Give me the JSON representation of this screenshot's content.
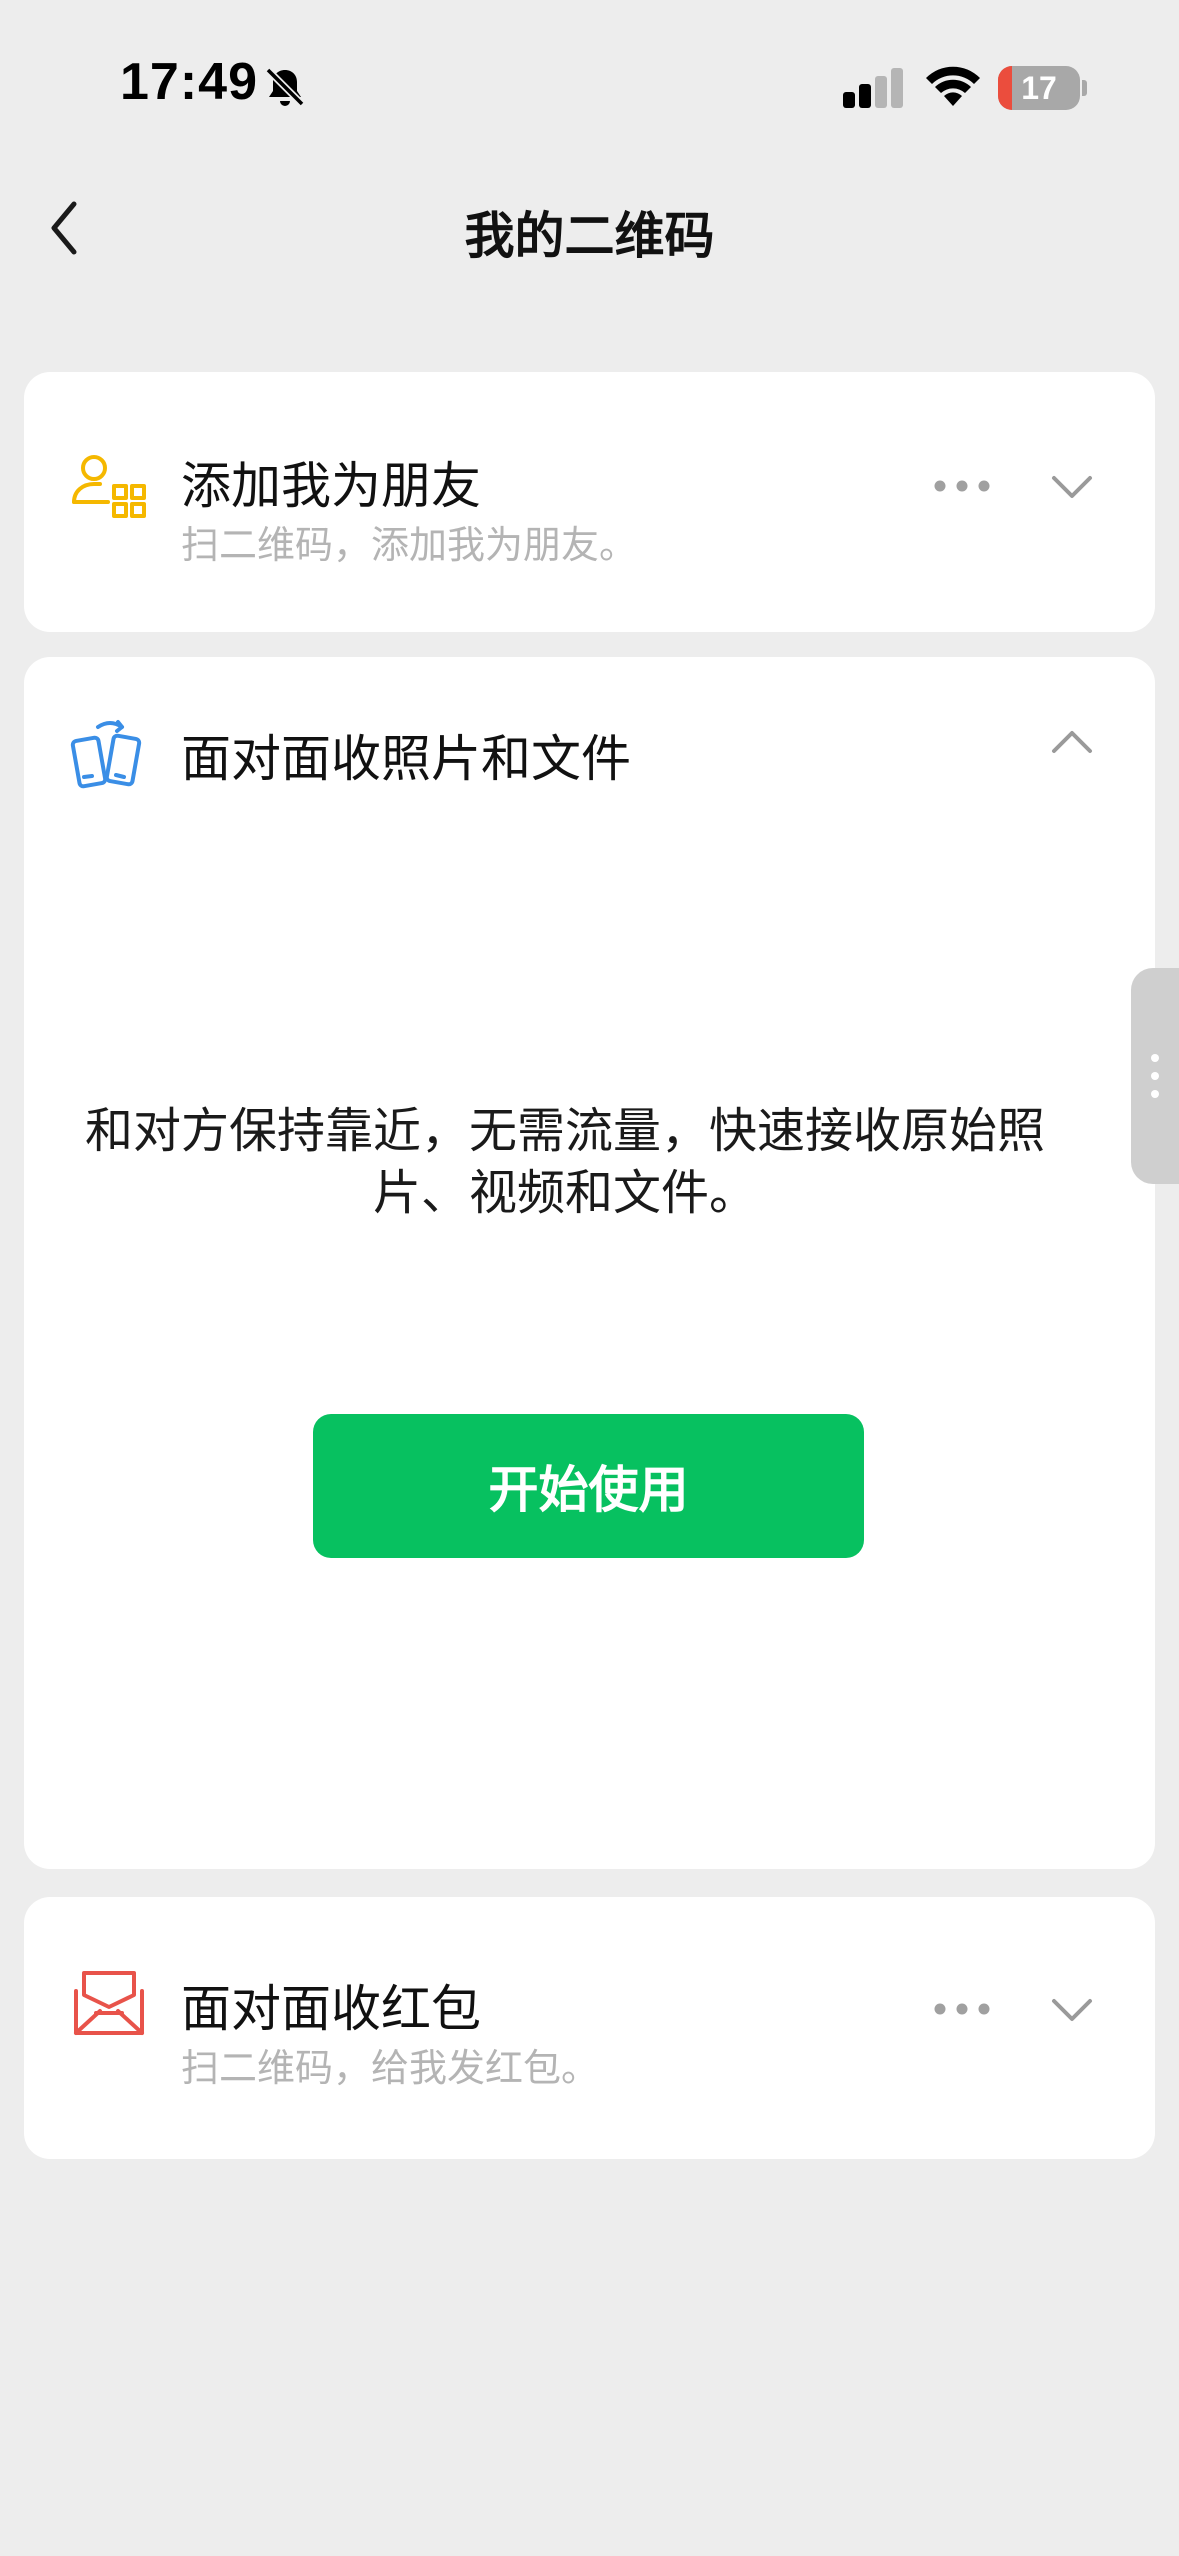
{
  "status_bar": {
    "time": "17:49",
    "battery": "17",
    "battery_level": 0.17,
    "icons": [
      "bell-slash-icon",
      "cellular-signal-icon",
      "wifi-icon",
      "battery-icon"
    ]
  },
  "nav": {
    "title": "我的二维码",
    "back_icon": "chevron-left-icon"
  },
  "cards": [
    {
      "title": "添加我为朋友",
      "subtitle": "扫二维码，添加我为朋友。",
      "icon": "person-qr-icon",
      "icon_color": "#f5b800",
      "expanded": false
    },
    {
      "title": "面对面收照片和文件",
      "icon": "phones-transfer-icon",
      "icon_color": "#3a8ee6",
      "expanded": true,
      "description": "和对方保持靠近，无需流量，快速接收原始照片、视频和文件。",
      "button": "开始使用"
    },
    {
      "title": "面对面收红包",
      "subtitle": "扫二维码，给我发红包。",
      "icon": "red-packet-icon",
      "icon_color": "#e8534a",
      "expanded": false
    }
  ],
  "colors": {
    "background": "#ededed",
    "card": "#ffffff",
    "primary_green": "#07c160",
    "subtitle_gray": "#b4b4b4",
    "battery_red": "#eb4d3d"
  }
}
